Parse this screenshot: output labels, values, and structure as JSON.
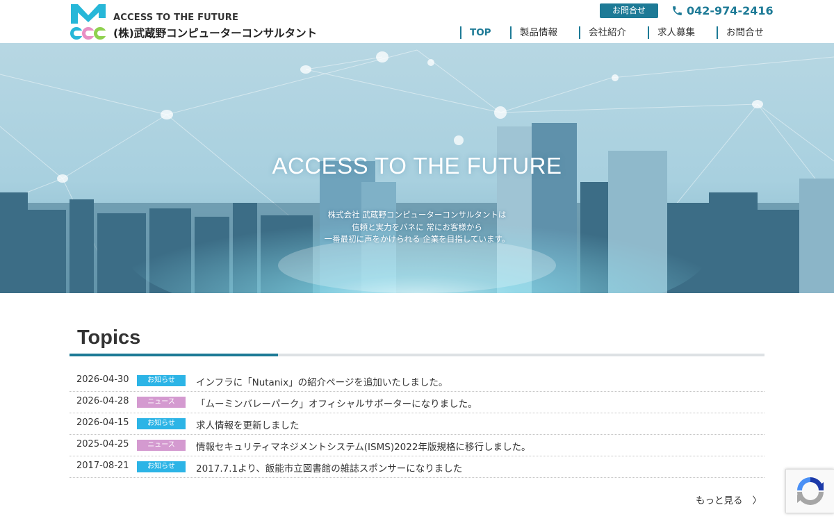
{
  "header": {
    "tagline": "ACCESS TO THE FUTURE",
    "company_name": "(株)武蔵野コンピューターコンサルタント",
    "contact_button": "お問合せ",
    "phone": "042-974-2416",
    "nav": [
      {
        "label": "TOP",
        "active": true
      },
      {
        "label": "製品情報",
        "active": false
      },
      {
        "label": "会社紹介",
        "active": false
      },
      {
        "label": "求人募集",
        "active": false
      },
      {
        "label": "お問合せ",
        "active": false
      }
    ]
  },
  "hero": {
    "title": "ACCESS TO THE FUTURE",
    "lines": [
      "株式会社 武蔵野コンピューターコンサルタントは",
      "信頼と実力をバネに 常にお客様から",
      "一番最初に声をかけられる 企業を目指しています。"
    ]
  },
  "topics": {
    "title": "Topics",
    "items": [
      {
        "date": "2026-04-30",
        "category": "お知らせ",
        "text": "インフラに「Nutanix」の紹介ページを追加いたしました。"
      },
      {
        "date": "2026-04-28",
        "category": "ニュース",
        "text": "「ムーミンバレーパーク」オフィシャルサポーターになりました。"
      },
      {
        "date": "2026-04-15",
        "category": "お知らせ",
        "text": "求人情報を更新しました"
      },
      {
        "date": "2025-04-25",
        "category": "ニュース",
        "text": "情報セキュリティマネジメントシステム(ISMS)2022年版規格に移行しました。"
      },
      {
        "date": "2017-08-21",
        "category": "お知らせ",
        "text": "2017.7.1より、飯能市立図書館の雑誌スポンサーになりました"
      }
    ],
    "more_label": "もっと見る",
    "more_arrow": "〉"
  },
  "colors": {
    "accent": "#1d7a96",
    "badge_notice": "#2cb4e6",
    "badge_news": "#d49ad0",
    "logo_cyan": "#27b7d8",
    "logo_pink": "#e88fc4",
    "logo_green": "#8fd14f"
  },
  "icons": {
    "phone": "phone-icon",
    "logo": "mcc-logo-icon",
    "recaptcha": "recaptcha-icon"
  }
}
